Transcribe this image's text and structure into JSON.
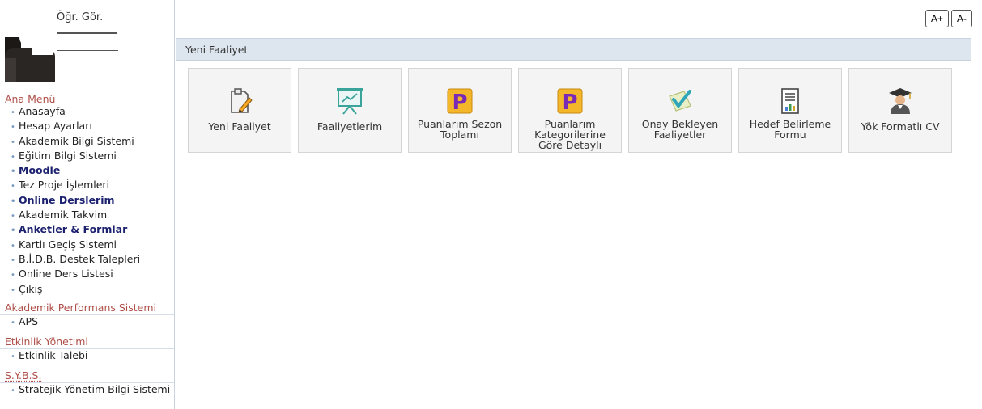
{
  "profile": {
    "title": "Öğr. Gör."
  },
  "sidebar": {
    "ana_menu": {
      "header": "Ana Menü",
      "items": [
        {
          "label": "Anasayfa",
          "bold": false
        },
        {
          "label": "Hesap Ayarları",
          "bold": false
        },
        {
          "label": "Akademik Bilgi Sistemi",
          "bold": false
        },
        {
          "label": "Eğitim Bilgi Sistemi",
          "bold": false
        },
        {
          "label": "Moodle",
          "bold": true
        },
        {
          "label": "Tez Proje İşlemleri",
          "bold": false
        },
        {
          "label": "Online Derslerim",
          "bold": true
        },
        {
          "label": "Akademik Takvim",
          "bold": false
        },
        {
          "label": "Anketler & Formlar",
          "bold": true
        },
        {
          "label": "Kartlı Geçiş Sistemi",
          "bold": false
        },
        {
          "label": "B.İ.D.B. Destek Talepleri",
          "bold": false
        },
        {
          "label": "Online Ders Listesi",
          "bold": false
        },
        {
          "label": "Çıkış",
          "bold": false
        }
      ]
    },
    "aps": {
      "header": "Akademik Performans Sistemi",
      "items": [
        {
          "label": "APS"
        }
      ]
    },
    "etkinlik": {
      "header": "Etkinlik Yönetimi",
      "items": [
        {
          "label": "Etkinlik Talebi"
        }
      ]
    },
    "sybs": {
      "header": "S.Y.B.S.",
      "items": [
        {
          "label": "Stratejik Yönetim Bilgi Sistemi"
        }
      ]
    }
  },
  "font_buttons": {
    "increase": "A+",
    "decrease": "A-"
  },
  "section_title": "Yeni Faaliyet",
  "tiles": [
    {
      "label": "Yeni Faaliyet",
      "icon": "edit-document-icon"
    },
    {
      "label": "Faaliyetlerim",
      "icon": "presentation-board-icon"
    },
    {
      "label": "Puanlarım Sezon Toplamı",
      "icon": "p-badge-icon"
    },
    {
      "label": "Puanlarım Kategorilerine Göre Detaylı",
      "icon": "p-badge-icon"
    },
    {
      "label": "Onay Bekleyen Faaliyetler",
      "icon": "checkmark-icon"
    },
    {
      "label": "Hedef Belirleme Formu",
      "icon": "report-document-icon"
    },
    {
      "label": "Yök Formatlı CV",
      "icon": "graduate-icon"
    }
  ],
  "colors": {
    "section_header": "#b0504a",
    "bold_link": "#1a1f6e",
    "bar_bg": "#dde6ef",
    "tile_bg": "#f4f4f4",
    "p_badge": "#f5b72a"
  }
}
